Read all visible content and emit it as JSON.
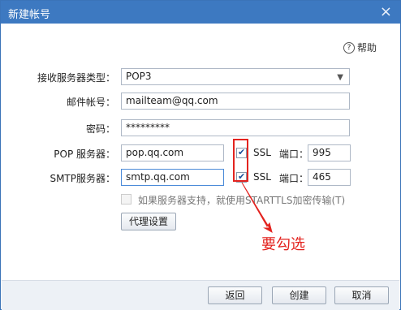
{
  "window": {
    "title": "新建帐号",
    "close": "×"
  },
  "help": {
    "label": "帮助",
    "icon": "?"
  },
  "form": {
    "server_type_label": "接收服务器类型：",
    "server_type_value": "POP3",
    "email_label": "邮件帐号：",
    "email_value": "mailteam@qq.com",
    "password_label": "密码：",
    "password_value": "*********",
    "pop_label": "POP 服务器：",
    "pop_value": "pop.qq.com",
    "smtp_label": "SMTP服务器：",
    "smtp_value": "smtp.qq.com",
    "ssl_label": "SSL",
    "port_label": "端口：",
    "pop_port": "995",
    "smtp_port": "465",
    "starttls_label": "如果服务器支持，就使用STARTTLS加密传输(T)",
    "proxy_button": "代理设置"
  },
  "annotation": {
    "text": "要勾选",
    "color": "#e3231f"
  },
  "footer": {
    "back": "返回",
    "create": "创建",
    "cancel": "取消"
  }
}
